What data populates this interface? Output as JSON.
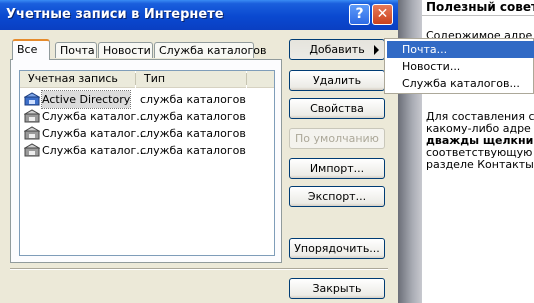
{
  "window": {
    "title": "Учетные записи в Интернете",
    "help_glyph": "?",
    "close_glyph": "✕"
  },
  "tabs": [
    {
      "label": "Все",
      "active": true
    },
    {
      "label": "Почта",
      "active": false
    },
    {
      "label": "Новости",
      "active": false
    },
    {
      "label": "Служба каталогов",
      "active": false
    }
  ],
  "list": {
    "columns": [
      "Учетная запись",
      "Тип"
    ],
    "rows": [
      {
        "name": "Active Directory",
        "type": "служба каталогов",
        "icon": "directory-service-icon"
      },
      {
        "name": "Служба каталог...",
        "type": "служба каталогов",
        "icon": "directory-service-icon"
      },
      {
        "name": "Служба каталог...",
        "type": "служба каталогов",
        "icon": "directory-service-icon"
      },
      {
        "name": "Служба каталог...",
        "type": "служба каталогов",
        "icon": "directory-service-icon"
      }
    ]
  },
  "buttons": {
    "add": "Добавить",
    "remove": "Удалить",
    "properties": "Свойства",
    "default": "По умолчанию",
    "import": "Импорт...",
    "export": "Экспорт...",
    "order": "Упорядочить...",
    "close": "Закрыть"
  },
  "add_menu": [
    "Почта...",
    "Новости...",
    "Служба каталогов..."
  ],
  "help_panel": {
    "title": "Полезный совет",
    "lines_top": [
      "Содержимое адре"
    ],
    "lines_bottom": [
      "Для составления с",
      "какому-либо адре",
      "дважды щелкни",
      "соответствующую",
      "разделе Контакты"
    ]
  },
  "colors": {
    "title_bar": "#0a49d0",
    "menu_highlight": "#316ac5",
    "tab_accent": "#e68b2c"
  }
}
